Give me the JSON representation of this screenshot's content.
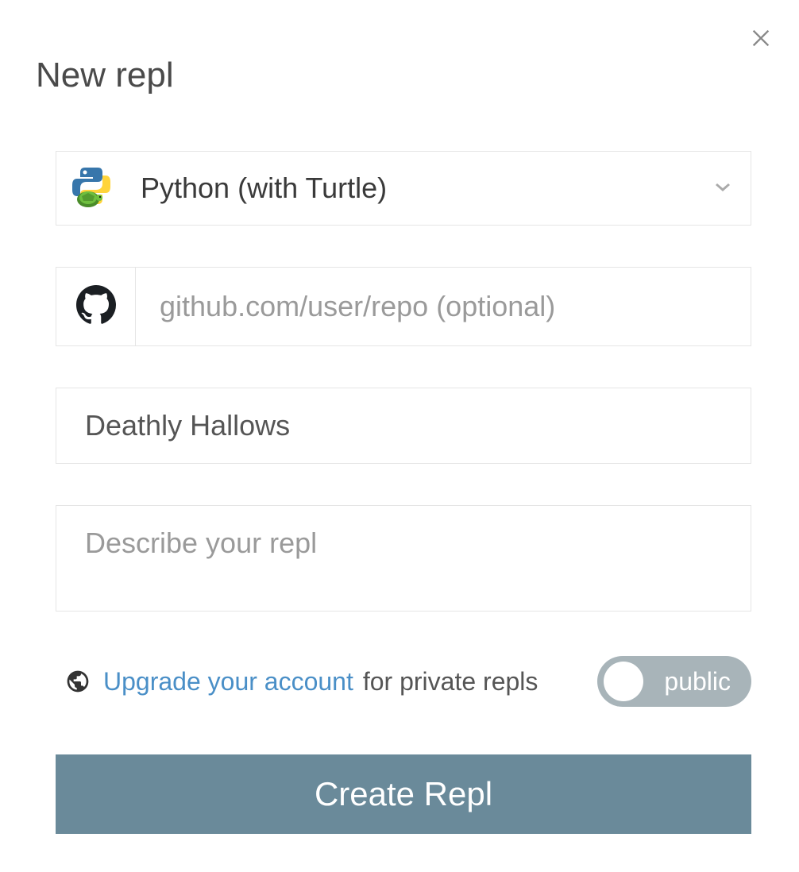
{
  "modal": {
    "title": "New repl"
  },
  "language": {
    "selected": "Python (with Turtle)"
  },
  "github": {
    "placeholder": "github.com/user/repo (optional)",
    "value": ""
  },
  "name": {
    "value": "Deathly Hallows"
  },
  "description": {
    "placeholder": "Describe your repl",
    "value": ""
  },
  "privacy": {
    "upgrade_link": "Upgrade your account",
    "suffix_text": "for private repls",
    "toggle_label": "public"
  },
  "actions": {
    "create_label": "Create Repl"
  }
}
